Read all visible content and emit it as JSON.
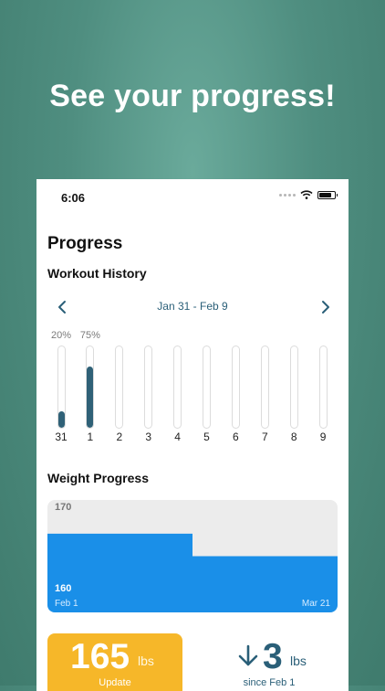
{
  "headline": "See your progress!",
  "status_bar": {
    "time": "6:06"
  },
  "page_title": "Progress",
  "workout_history": {
    "title": "Workout History",
    "date_range": "Jan 31 - Feb 9",
    "days": [
      {
        "label": "31",
        "fill": 0.2,
        "percent_label": "20%"
      },
      {
        "label": "1",
        "fill": 0.75,
        "percent_label": "75%"
      },
      {
        "label": "2",
        "fill": 0,
        "percent_label": ""
      },
      {
        "label": "3",
        "fill": 0,
        "percent_label": ""
      },
      {
        "label": "4",
        "fill": 0,
        "percent_label": ""
      },
      {
        "label": "5",
        "fill": 0,
        "percent_label": ""
      },
      {
        "label": "6",
        "fill": 0,
        "percent_label": ""
      },
      {
        "label": "7",
        "fill": 0,
        "percent_label": ""
      },
      {
        "label": "8",
        "fill": 0,
        "percent_label": ""
      },
      {
        "label": "9",
        "fill": 0,
        "percent_label": ""
      }
    ]
  },
  "weight_progress": {
    "title": "Weight Progress",
    "y_top_label": "170",
    "y_bottom_label": "160",
    "x_start_label": "Feb 1",
    "x_end_label": "Mar 21",
    "accent_color": "#1a8fe8"
  },
  "chart_data": {
    "type": "area",
    "x": [
      "Feb 1",
      "Mar 21"
    ],
    "series": [
      {
        "values": [
          167,
          165
        ]
      }
    ],
    "ylim": [
      160,
      170
    ]
  },
  "current_weight": {
    "value": "165",
    "unit": "lbs",
    "label": "Update"
  },
  "weight_change": {
    "value": "3",
    "unit": "lbs",
    "label": "since Feb 1",
    "direction": "down"
  },
  "colors": {
    "primary_dark": "#2f6177",
    "update_card": "#f6b729",
    "background": "#5a9a8b"
  }
}
